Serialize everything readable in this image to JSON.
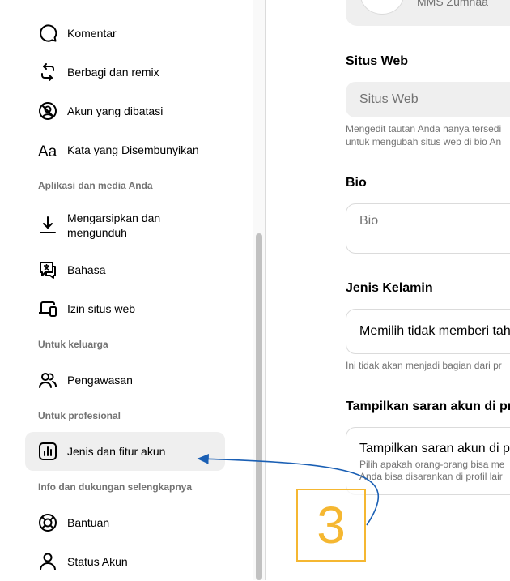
{
  "sidebar": {
    "items": [
      {
        "label": "Komentar",
        "icon": "comment-icon"
      },
      {
        "label": "Berbagi dan remix",
        "icon": "share-remix-icon"
      },
      {
        "label": "Akun yang dibatasi",
        "icon": "restricted-account-icon"
      },
      {
        "label": "Kata yang Disembunyikan",
        "icon": "hidden-words-icon"
      },
      {
        "label": "Mengarsipkan dan mengunduh",
        "icon": "download-icon"
      },
      {
        "label": "Bahasa",
        "icon": "language-icon"
      },
      {
        "label": "Izin situs web",
        "icon": "website-permissions-icon"
      },
      {
        "label": "Pengawasan",
        "icon": "supervision-icon"
      },
      {
        "label": "Jenis dan fitur akun",
        "icon": "account-type-icon",
        "active": true
      },
      {
        "label": "Bantuan",
        "icon": "help-lifebuoy-icon"
      },
      {
        "label": "Status Akun",
        "icon": "account-status-icon"
      }
    ],
    "sections": {
      "apps_media": "Aplikasi dan media Anda",
      "family": "Untuk keluarga",
      "professional": "Untuk profesional",
      "info_support": "Info dan dukungan selengkapnya"
    }
  },
  "main": {
    "profile_name": "MMS Zumnaa",
    "website": {
      "title": "Situs Web",
      "placeholder": "Situs Web",
      "help_line1": "Mengedit tautan Anda hanya tersedi",
      "help_line2": "untuk mengubah situs web di bio An"
    },
    "bio": {
      "title": "Bio",
      "placeholder": "Bio"
    },
    "gender": {
      "title": "Jenis Kelamin",
      "value": "Memilih tidak memberi tah",
      "help": "Ini tidak akan menjadi bagian dari pr"
    },
    "suggestions": {
      "title": "Tampilkan saran akun di pr",
      "box_title": "Tampilkan saran akun di p",
      "box_line1": "Pilih apakah orang-orang bisa me",
      "box_line2": "Anda bisa disarankan di profil lair"
    }
  },
  "annotation": {
    "number": "3",
    "color": "#f5b731",
    "arrow_color": "#1a5fb4"
  }
}
